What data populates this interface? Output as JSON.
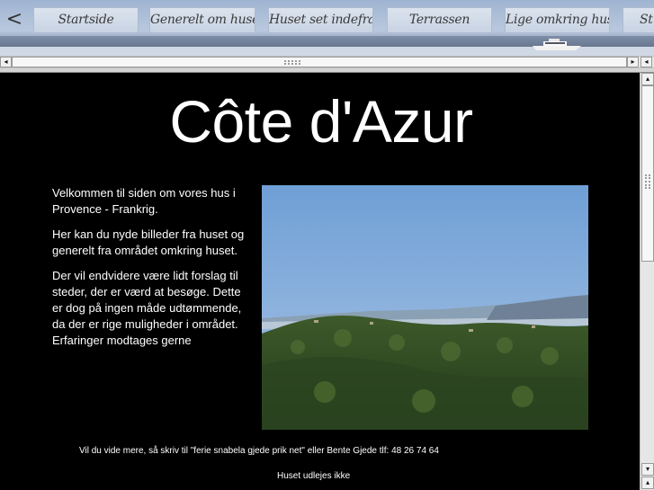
{
  "nav": {
    "back_symbol": "<",
    "tabs": [
      {
        "label": "Startside"
      },
      {
        "label": "Generelt om huset"
      },
      {
        "label": "Huset set indefra"
      },
      {
        "label": "Terrassen"
      },
      {
        "label": "Lige omkring huset"
      },
      {
        "label": "St"
      }
    ]
  },
  "main": {
    "title": "Côte d'Azur",
    "paragraphs": [
      "Velkommen til siden om vores hus i Provence - Frankrig.",
      "Her kan du nyde billeder fra huset og generelt fra området omkring huset.",
      "Der vil endvidere være lidt forslag til steder, der er værd at besøge. Dette er dog på ingen måde udtømmende, da der er rige muligheder i området. Erfaringer modtages gerne"
    ],
    "contact": "Vil du vide mere, så skriv til \"ferie snabela gjede prik net\" eller Bente Gjede tlf: 48 26 74 64",
    "rent_status": "Huset udlejes ikke"
  },
  "scrollbars": {
    "left_arrow": "◂",
    "right_arrow": "▸",
    "up_arrow": "▴",
    "down_arrow": "▾"
  }
}
